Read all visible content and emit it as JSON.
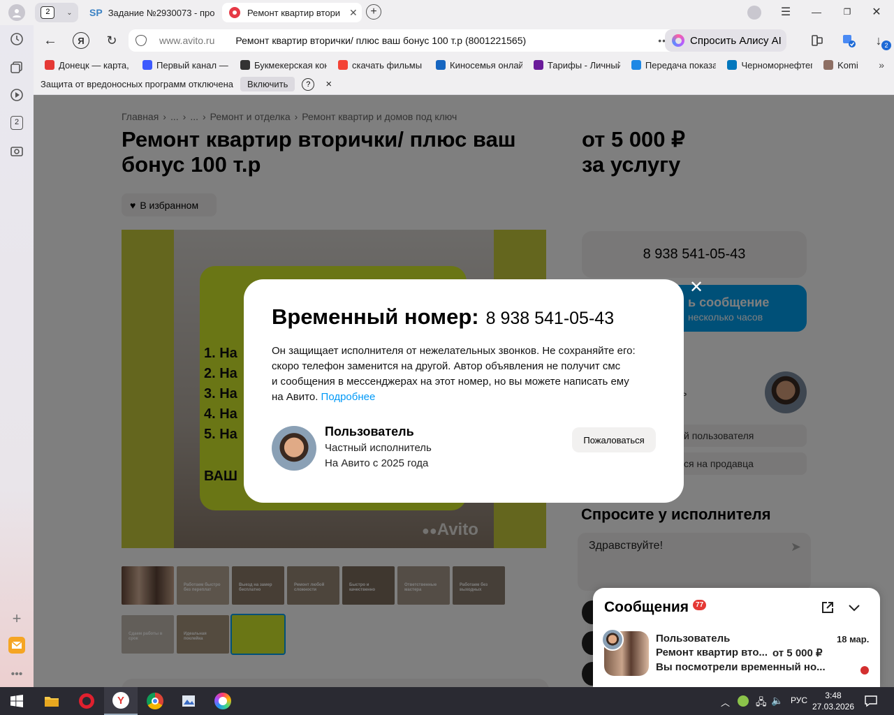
{
  "browser": {
    "tab_count": "2",
    "tabs": [
      {
        "label": "Задание №2930073 - про",
        "favicon": "SP"
      },
      {
        "label": "Ремонт квартир втори"
      }
    ],
    "address": {
      "domain": "www.avito.ru",
      "title": "Ремонт квартир вторички/ плюс ваш бонус 100 т.р (8001221565)"
    },
    "alice_button": "Спросить Алису AI",
    "downloads_badge": "2",
    "bookmarks": [
      {
        "label": "Донецк — карта, с",
        "color": "#e53935"
      },
      {
        "label": "Первый канал — с",
        "color": "#3d5afe"
      },
      {
        "label": "Букмекерская кон",
        "color": "#333333"
      },
      {
        "label": "скачать фильмы 2",
        "color": "#f44336"
      },
      {
        "label": "Киносемья онлай",
        "color": "#1565c0"
      },
      {
        "label": "Тарифы - Личный",
        "color": "#6a1b9a"
      },
      {
        "label": "Передача показа",
        "color": "#1e88e5"
      },
      {
        "label": "Черноморнефтег",
        "color": "#0277bd"
      },
      {
        "label": "Komi",
        "color": "#8d6e63"
      }
    ],
    "infobar": {
      "text": "Защита от вредоносных программ отключена",
      "enable_button": "Включить",
      "help": "?",
      "close": "×"
    },
    "sidebar_badge": "2"
  },
  "listing": {
    "breadcrumb": [
      "Главная",
      "...",
      "...",
      "Ремонт и отделка",
      "Ремонт квартир и домов под ключ"
    ],
    "title": "Ремонт квартир вторички/ плюс ваш бонус 100 т.р",
    "price_line1": "от 5 000 ₽",
    "price_line2": "за услугу",
    "favorite_button": "В избранном",
    "phone_button": "8 938 541-05-43",
    "message_button": "ь сообщение",
    "message_sub": "несколько часов",
    "seller_partial": "ь",
    "reviews_partial": "й пользователя",
    "subscribe_partial": "ся на продавца",
    "ask_heading": "Спросите у исполнителя",
    "ask_placeholder": "Здравствуйте!",
    "image_list": [
      "1. На",
      "2. На",
      "3. На",
      "4. На",
      "5. На"
    ],
    "image_footer": "ВАШ",
    "watermark": "Avito",
    "thumb_captions": [
      "",
      "Работаем быстро без переплат",
      "Выезд на замер бесплатно",
      "Ремонт любой сложности",
      "Быстро и качественно",
      "Ответственные мастера",
      "Работаем без выходных",
      "Сдаем работы в срок",
      "Идеальная поклейка",
      ""
    ]
  },
  "modal": {
    "title": "Временный номер:",
    "phone": "8 938 541-05-43",
    "body_lines": [
      "Он защищает исполнителя от нежелательных звонков. Не сохраняйте его:",
      "скоро телефон заменится на другой. Автор объявления не получит смс",
      "и сообщения в мессенджерах на этот номер, но вы можете написать ему"
    ],
    "body_last": "на Авито.",
    "more_link": "Подробнее",
    "user_name": "Пользователь",
    "user_type": "Частный исполнитель",
    "user_since": "На Авито с 2025 года",
    "report_button": "Пожаловаться"
  },
  "messages": {
    "title": "Сообщения",
    "badge": "77",
    "sender": "Пользователь",
    "date": "18 мар.",
    "subject": "Ремонт квартир вто...",
    "price": "от 5 000 ₽",
    "preview": "Вы посмотрели временный но..."
  },
  "taskbar": {
    "lang": "РУС",
    "time": "3:48",
    "date": "27.03.2026"
  }
}
